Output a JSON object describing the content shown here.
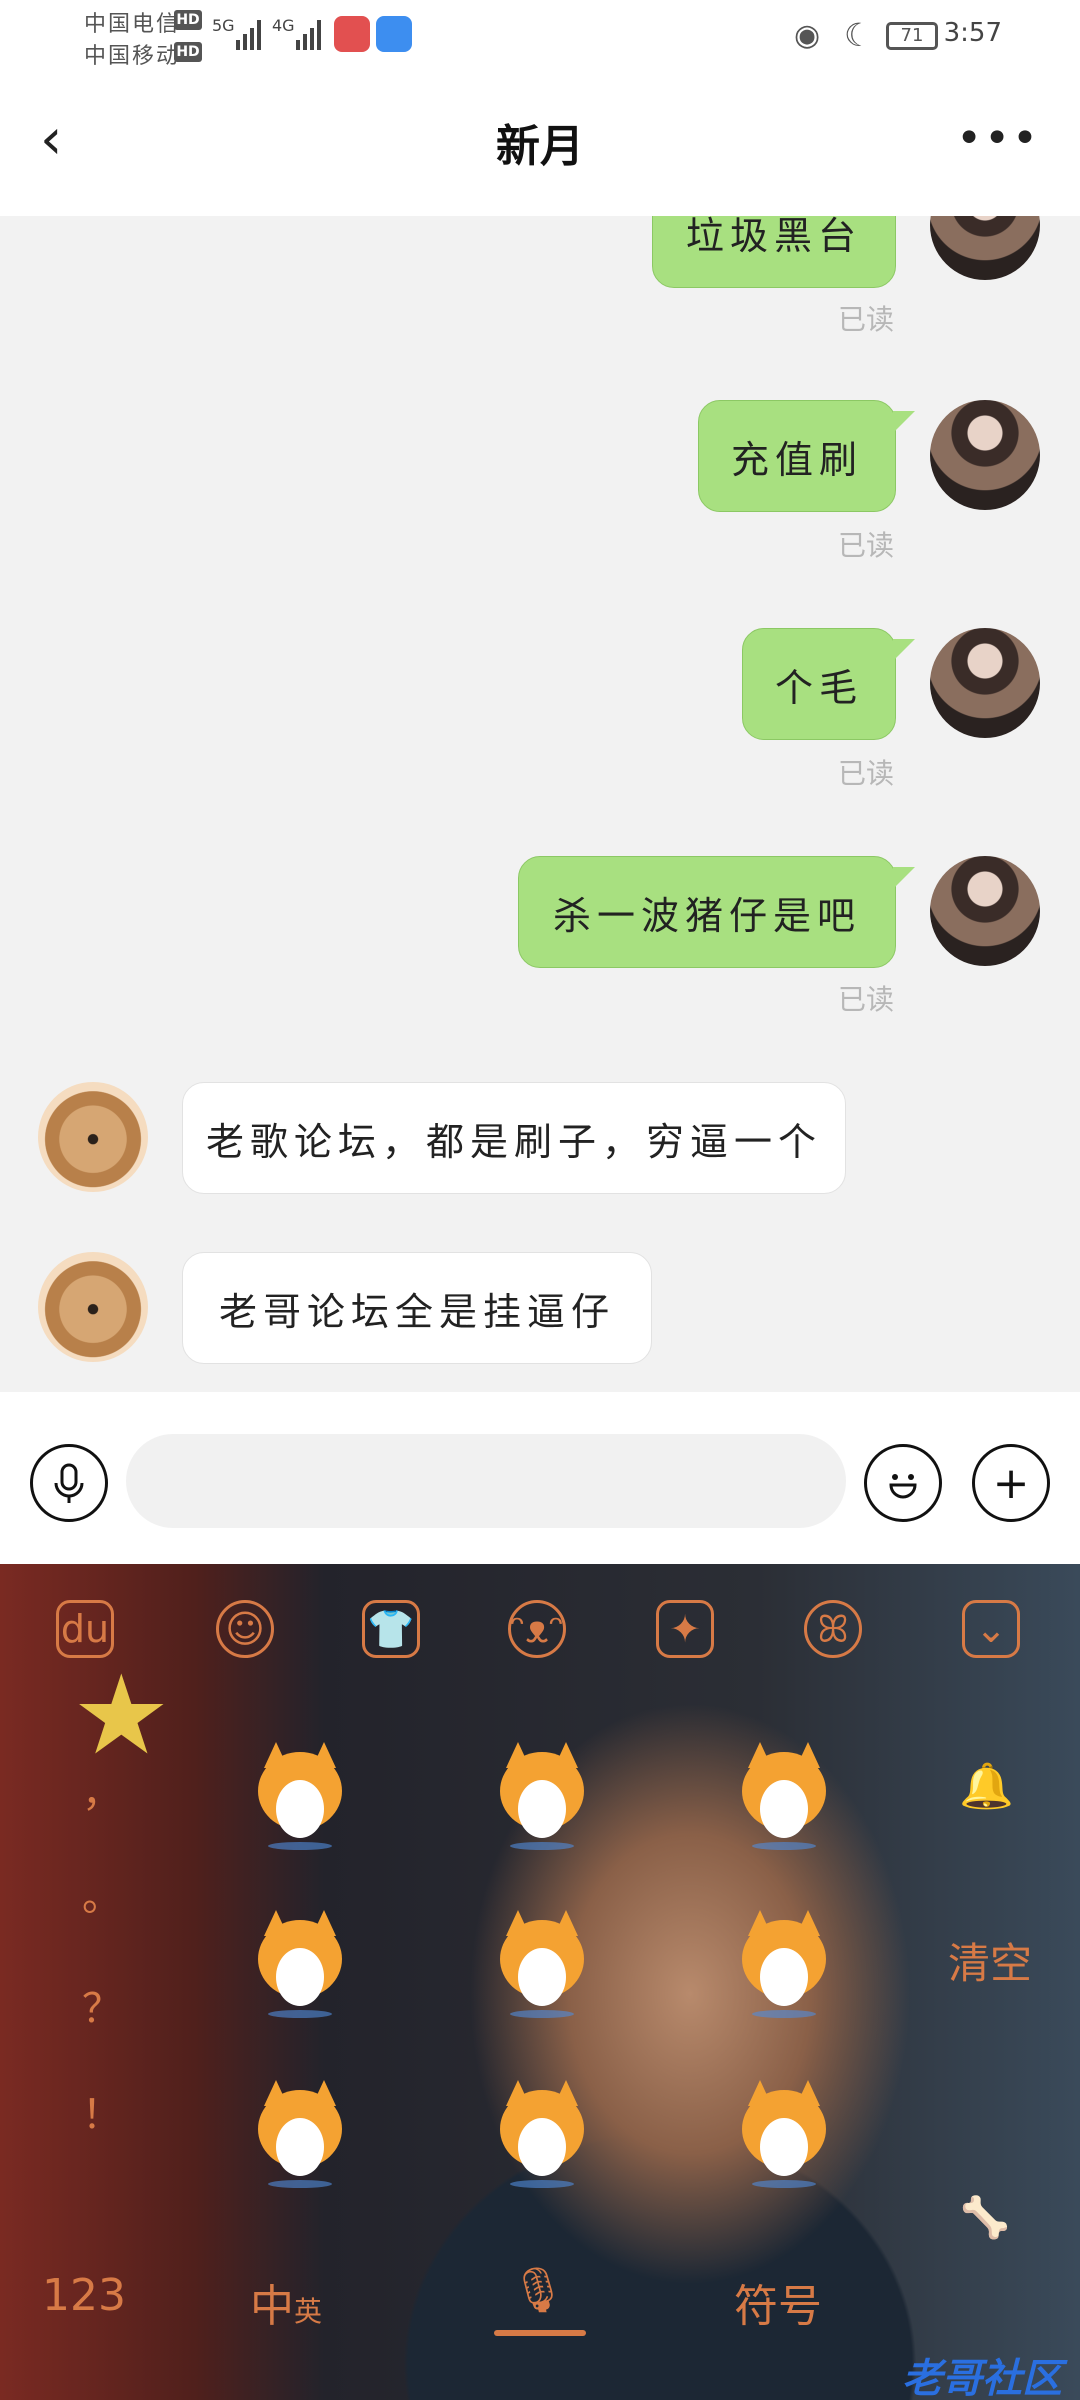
{
  "status_bar": {
    "carrier_1": "中国电信",
    "carrier_2": "中国移动",
    "hd_label": "HD",
    "network_1": "5G",
    "network_2": "4G",
    "battery": "71",
    "time": "3:57",
    "icons": [
      "eye-icon",
      "moon-icon",
      "battery-icon"
    ]
  },
  "header": {
    "title": "新月",
    "back_icon": "chevron-left-icon",
    "more_icon": "more-dots-icon"
  },
  "messages": [
    {
      "from": "me",
      "text": "垃圾黑台",
      "status": "已读"
    },
    {
      "from": "me",
      "text": "充值刷",
      "status": "已读"
    },
    {
      "from": "me",
      "text": "个毛",
      "status": "已读"
    },
    {
      "from": "me",
      "text": "杀一波猪仔是吧",
      "status": "已读"
    },
    {
      "from": "other",
      "text": "老歌论坛，都是刷子，穷逼一个"
    },
    {
      "from": "other",
      "text": "老哥论坛全是挂逼仔"
    }
  ],
  "input_bar": {
    "placeholder": "",
    "voice_icon": "microphone-icon",
    "emoji_icon": "smiley-icon",
    "add_icon": "plus-icon"
  },
  "keyboard": {
    "toolbar_icons": [
      "du-logo-icon",
      "wink-smiley-icon",
      "tshirt-icon",
      "emoticon-icon",
      "sticker-icon",
      "fox-icon",
      "collapse-keyboard-icon"
    ],
    "punctuation": [
      "，",
      "。",
      "？",
      "！"
    ],
    "clear_label": "清空",
    "key_123": "123",
    "key_lang": "中",
    "key_lang_alt": "英",
    "key_symbols": "符号",
    "watermark": "老哥社区",
    "accent_color": "#d77a46"
  }
}
